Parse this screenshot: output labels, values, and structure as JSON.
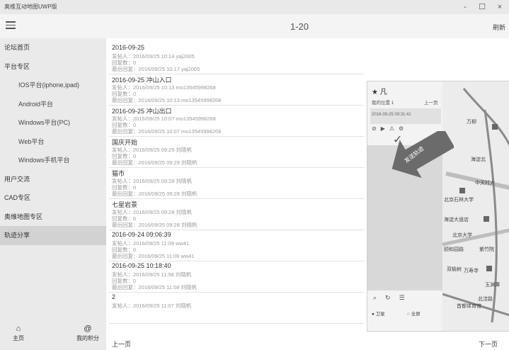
{
  "window": {
    "title": "奥维互动地图UWP版",
    "minimize": "-",
    "maximize": "☐",
    "close": "×"
  },
  "header": {
    "menu_icon": "menu-icon",
    "page": "1-20",
    "refresh_label": "刷新"
  },
  "sidebar": {
    "items": [
      {
        "label": "论坛首页",
        "sub": false
      },
      {
        "label": "平台专区",
        "sub": false
      },
      {
        "label": "IOS平台(iphone,ipad)",
        "sub": true
      },
      {
        "label": "Android平台",
        "sub": true
      },
      {
        "label": "Windows平台(PC)",
        "sub": true
      },
      {
        "label": "Web平台",
        "sub": true
      },
      {
        "label": "Windows手机平台",
        "sub": true
      },
      {
        "label": "用户交流",
        "sub": false
      },
      {
        "label": "CAD专区",
        "sub": false
      },
      {
        "label": "奥维地图专区",
        "sub": false
      },
      {
        "label": "轨迹分享",
        "sub": false,
        "active": true
      }
    ],
    "bottom": {
      "home_label": "主页",
      "mine_label": "我的积分"
    }
  },
  "entries": [
    {
      "title": "2016-09-25",
      "line1": "发帖人：2016/09/25 10:14 yaj2005",
      "line2": "回复数：0",
      "line3": "最后回复：2016/09/25 10:17 yaj2005"
    },
    {
      "title": "2016-09-25 冲山入口",
      "line1": "发帖人：2016/09/25 10:13 mo13545998268",
      "line2": "回复数：0",
      "line3": "最后回复：2016/09/25 10:13 mo13545998268"
    },
    {
      "title": "2016-09-25 冲山出口",
      "line1": "发帖人：2016/09/25 10:07 mo13545998268",
      "line2": "回复数：0",
      "line3": "最后回复：2016/09/25 10:07 mo13545998268"
    },
    {
      "title": "国庆开始",
      "line1": "发帖人：2016/09/25 09:29 刘晓帆",
      "line2": "回复数：0",
      "line3": "最后回复：2016/09/25 09:29 刘晓帆"
    },
    {
      "title": "猫市",
      "line1": "发帖人：2016/09/25 09:28 刘晓帆",
      "line2": "回复数：0",
      "line3": "最后回复：2016/09/25 09:28 刘晓帆"
    },
    {
      "title": "七星岩景",
      "line1": "发帖人：2016/09/25 09:28 刘晓帆",
      "line2": "回复数：0",
      "line3": "最后回复：2016/09/25 09:28 刘晓帆"
    },
    {
      "title": "2016-09-24 09:06:39",
      "line1": "发帖人：2016/09/25 11:09 ww41",
      "line2": "回复数：0",
      "line3": "最后回复：2016/09/25 11:09 ww41"
    },
    {
      "title": "2016-09-25 10:18:40",
      "line1": "发帖人：2016/09/25 11:58 刘晓帆",
      "line2": "回复数：0",
      "line3": "最后回复：2016/09/25 11:58 刘晓帆"
    },
    {
      "title": "2",
      "line1": "发帖人：2016/09/25 11:07 刘晓帆",
      "line2": "",
      "line3": ""
    }
  ],
  "footer": {
    "prev_label": "上一页",
    "next_label": "下一页"
  },
  "phone": {
    "top_icons": "★ 凡",
    "track_name": "我的位置 1",
    "prev": "上一页",
    "date": "2016-09-25 09:31:41",
    "arrow_label": "发送轨迹",
    "map_labels": [
      "万柳",
      "海淀北",
      "中关村大",
      "北京石林大学",
      "海淀大道店",
      "北京大学",
      "紫竹院",
      "玉渊潭",
      "颐和园路",
      "双榆树",
      "万寿寺",
      "首都体育馆",
      "北洼路"
    ],
    "foot_label1": "● 卫星",
    "foot_label2": "○ 全屏"
  }
}
